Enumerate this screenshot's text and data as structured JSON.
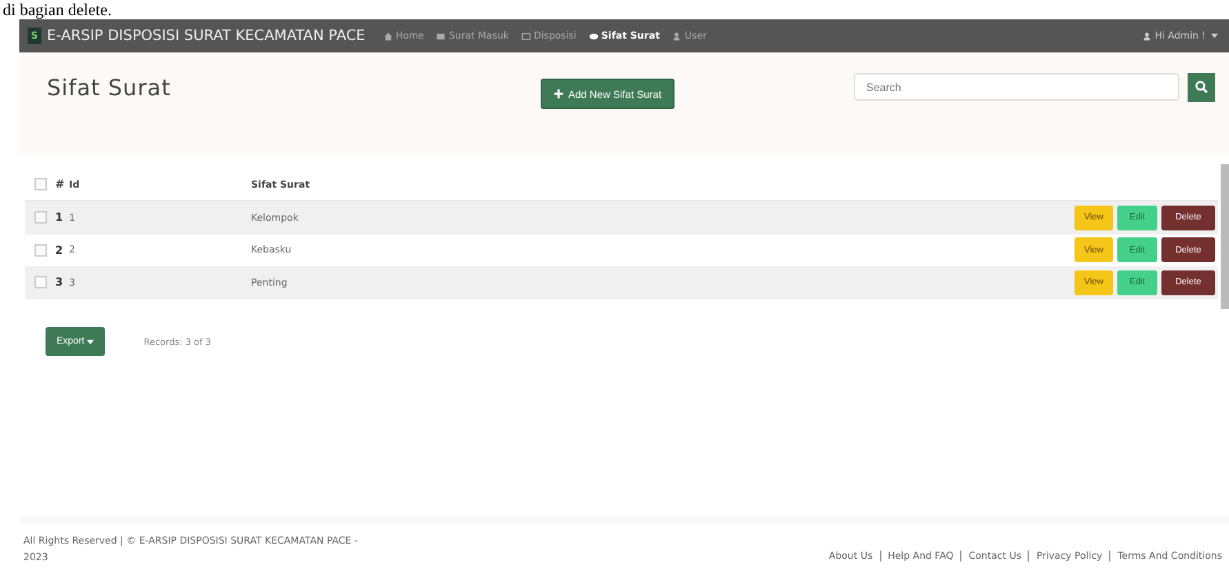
{
  "caption": "di bagian delete.",
  "navbar": {
    "brand_icon": "S",
    "brand": "E-ARSIP DISPOSISI SURAT KECAMATAN PACE",
    "items": [
      {
        "label": "Home",
        "selected": false
      },
      {
        "label": "Surat Masuk",
        "selected": false
      },
      {
        "label": "Disposisi",
        "selected": false
      },
      {
        "label": "Sifat Surat",
        "selected": true
      },
      {
        "label": "User",
        "selected": false
      }
    ],
    "account": "Hi Admin !"
  },
  "page_title": "Sifat Surat",
  "add_button": "Add New Sifat Surat",
  "search": {
    "placeholder": "Search"
  },
  "table": {
    "columns": [
      "#",
      "Id",
      "Sifat Surat"
    ],
    "all_checked": false,
    "rows": [
      {
        "no": "1",
        "id": "1",
        "sifat": "Kelompok",
        "checked": false,
        "actions": [
          "View",
          "Edit",
          "Delete"
        ]
      },
      {
        "no": "2",
        "id": "2",
        "sifat": "Kebasku",
        "checked": false,
        "actions": [
          "View",
          "Edit",
          "Delete"
        ]
      },
      {
        "no": "3",
        "id": "3",
        "sifat": "Penting",
        "checked": false,
        "actions": [
          "View",
          "Edit",
          "Delete"
        ]
      }
    ]
  },
  "export_button": "Export",
  "records": "Records: 3 of 3",
  "footer": {
    "copyright": "All Rights Reserved | © E-ARSIP DISPOSISI SURAT KECAMATAN PACE - 2023",
    "links": [
      "About Us",
      "Help And FAQ",
      "Contact Us",
      "Privacy Policy",
      "Terms And Conditions"
    ]
  }
}
